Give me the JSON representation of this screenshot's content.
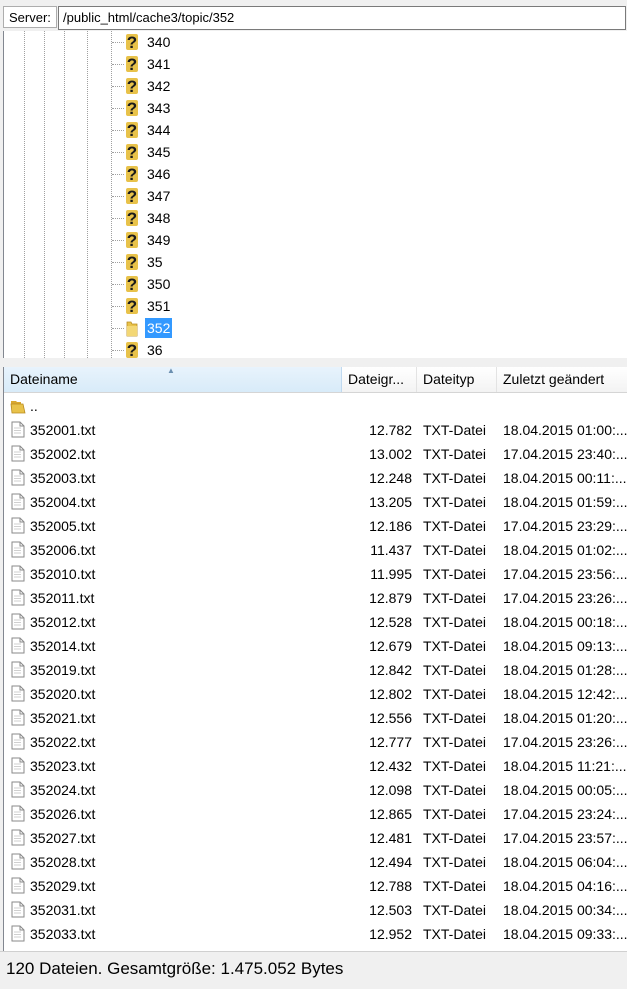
{
  "pathbar": {
    "label": "Server:",
    "path": "/public_html/cache3/topic/352"
  },
  "tree": {
    "nodes": [
      {
        "label": "340",
        "icon": "unknown-folder-icon"
      },
      {
        "label": "341",
        "icon": "unknown-folder-icon"
      },
      {
        "label": "342",
        "icon": "unknown-folder-icon"
      },
      {
        "label": "343",
        "icon": "unknown-folder-icon"
      },
      {
        "label": "344",
        "icon": "unknown-folder-icon"
      },
      {
        "label": "345",
        "icon": "unknown-folder-icon"
      },
      {
        "label": "346",
        "icon": "unknown-folder-icon"
      },
      {
        "label": "347",
        "icon": "unknown-folder-icon"
      },
      {
        "label": "348",
        "icon": "unknown-folder-icon"
      },
      {
        "label": "349",
        "icon": "unknown-folder-icon"
      },
      {
        "label": "35",
        "icon": "unknown-folder-icon"
      },
      {
        "label": "350",
        "icon": "unknown-folder-icon"
      },
      {
        "label": "351",
        "icon": "unknown-folder-icon"
      },
      {
        "label": "352",
        "icon": "open-folder-icon",
        "selected": true
      },
      {
        "label": "36",
        "icon": "unknown-folder-icon"
      }
    ]
  },
  "list": {
    "columns": {
      "name": "Dateiname",
      "size": "Dateigr...",
      "type": "Dateityp",
      "modified": "Zuletzt geändert"
    },
    "parent_label": "..",
    "rows": [
      {
        "name": "352001.txt",
        "size": "12.782",
        "type": "TXT-Datei",
        "modified": "18.04.2015 01:00:..."
      },
      {
        "name": "352002.txt",
        "size": "13.002",
        "type": "TXT-Datei",
        "modified": "17.04.2015 23:40:..."
      },
      {
        "name": "352003.txt",
        "size": "12.248",
        "type": "TXT-Datei",
        "modified": "18.04.2015 00:11:..."
      },
      {
        "name": "352004.txt",
        "size": "13.205",
        "type": "TXT-Datei",
        "modified": "18.04.2015 01:59:..."
      },
      {
        "name": "352005.txt",
        "size": "12.186",
        "type": "TXT-Datei",
        "modified": "17.04.2015 23:29:..."
      },
      {
        "name": "352006.txt",
        "size": "11.437",
        "type": "TXT-Datei",
        "modified": "18.04.2015 01:02:..."
      },
      {
        "name": "352010.txt",
        "size": "11.995",
        "type": "TXT-Datei",
        "modified": "17.04.2015 23:56:..."
      },
      {
        "name": "352011.txt",
        "size": "12.879",
        "type": "TXT-Datei",
        "modified": "17.04.2015 23:26:..."
      },
      {
        "name": "352012.txt",
        "size": "12.528",
        "type": "TXT-Datei",
        "modified": "18.04.2015 00:18:..."
      },
      {
        "name": "352014.txt",
        "size": "12.679",
        "type": "TXT-Datei",
        "modified": "18.04.2015 09:13:..."
      },
      {
        "name": "352019.txt",
        "size": "12.842",
        "type": "TXT-Datei",
        "modified": "18.04.2015 01:28:..."
      },
      {
        "name": "352020.txt",
        "size": "12.802",
        "type": "TXT-Datei",
        "modified": "18.04.2015 12:42:..."
      },
      {
        "name": "352021.txt",
        "size": "12.556",
        "type": "TXT-Datei",
        "modified": "18.04.2015 01:20:..."
      },
      {
        "name": "352022.txt",
        "size": "12.777",
        "type": "TXT-Datei",
        "modified": "17.04.2015 23:26:..."
      },
      {
        "name": "352023.txt",
        "size": "12.432",
        "type": "TXT-Datei",
        "modified": "18.04.2015 11:21:..."
      },
      {
        "name": "352024.txt",
        "size": "12.098",
        "type": "TXT-Datei",
        "modified": "18.04.2015 00:05:..."
      },
      {
        "name": "352026.txt",
        "size": "12.865",
        "type": "TXT-Datei",
        "modified": "17.04.2015 23:24:..."
      },
      {
        "name": "352027.txt",
        "size": "12.481",
        "type": "TXT-Datei",
        "modified": "17.04.2015 23:57:..."
      },
      {
        "name": "352028.txt",
        "size": "12.494",
        "type": "TXT-Datei",
        "modified": "18.04.2015 06:04:..."
      },
      {
        "name": "352029.txt",
        "size": "12.788",
        "type": "TXT-Datei",
        "modified": "18.04.2015 04:16:..."
      },
      {
        "name": "352031.txt",
        "size": "12.503",
        "type": "TXT-Datei",
        "modified": "18.04.2015 00:34:..."
      },
      {
        "name": "352033.txt",
        "size": "12.952",
        "type": "TXT-Datei",
        "modified": "18.04.2015 09:33:..."
      }
    ]
  },
  "status": {
    "text": "120 Dateien. Gesamtgröße: 1.475.052 Bytes"
  },
  "colors": {
    "selection": "#3399ff",
    "folder": "#e8c24a",
    "unknown_icon": "#1a1a1a"
  }
}
